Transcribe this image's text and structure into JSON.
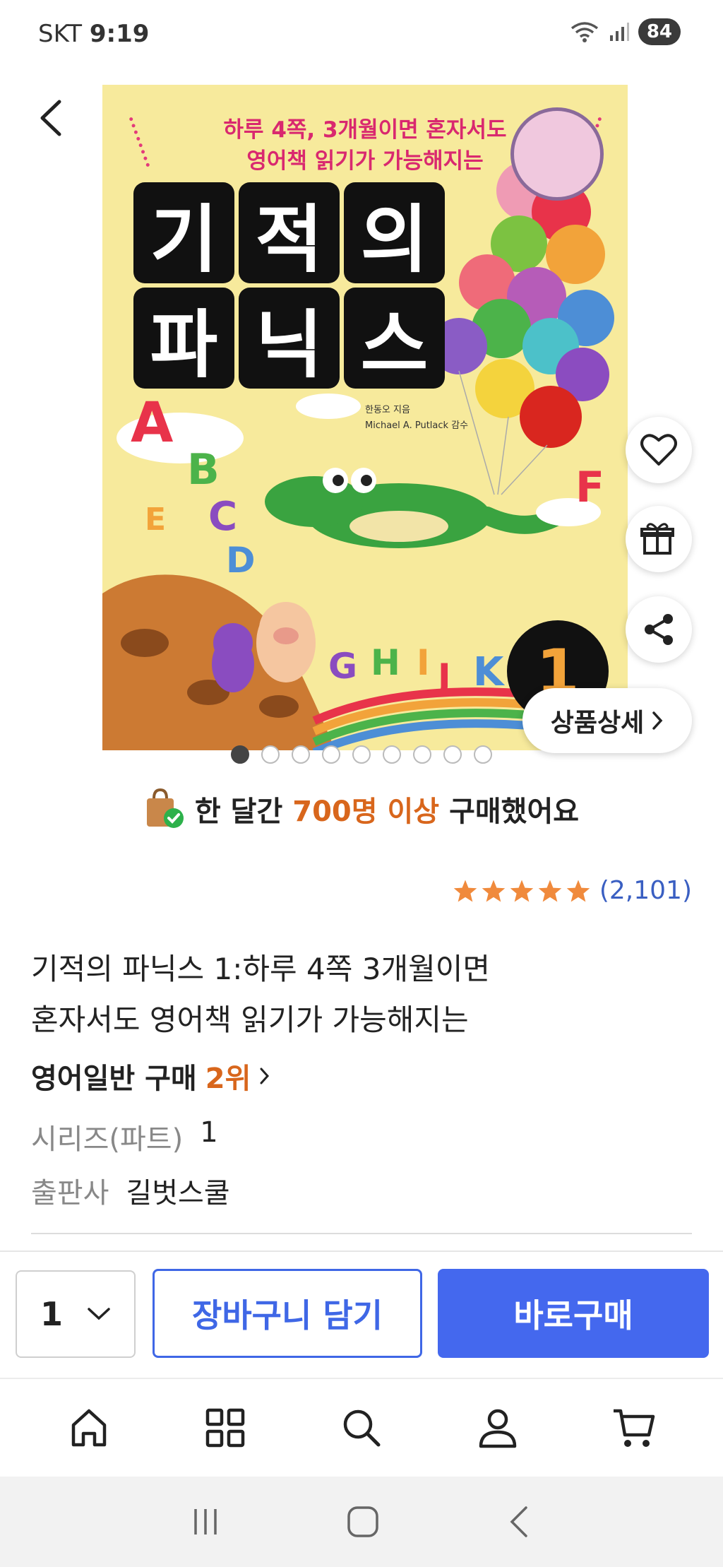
{
  "status_bar": {
    "carrier": "SKT",
    "time": "9:19",
    "battery": "84"
  },
  "cover": {
    "subtitle_line1": "하루 4쪽, 3개월이면 혼자서도",
    "subtitle_line2": "영어책 읽기가 가능해지는",
    "title_tiles": [
      "기",
      "적",
      "의",
      "파",
      "닉",
      "스"
    ],
    "author_line1": "한동오 지음",
    "author_line2": "Michael A. Putlack 감수",
    "volume": "1",
    "letters": [
      "A",
      "B",
      "C",
      "D",
      "E",
      "F",
      "G",
      "H",
      "I",
      "J",
      "K"
    ]
  },
  "side_actions": {
    "detail_label": "상품상세"
  },
  "pagination": {
    "total": 9,
    "active_index": 0
  },
  "purchase_banner": {
    "prefix": "한 달간",
    "highlight": "700명 이상",
    "suffix": "구매했어요"
  },
  "rating": {
    "stars": 5,
    "count": "(2,101)"
  },
  "product": {
    "title_line1": "기적의 파닉스 1:하루 4쪽 3개월이면",
    "title_line2": "혼자서도 영어책 읽기가 가능해지는",
    "rank_category": "영어일반 구매",
    "rank": "2위",
    "series_label": "시리즈(파트)",
    "series_value": "1",
    "publisher_label": "출판사",
    "publisher_value": "길벗스쿨"
  },
  "action_bar": {
    "quantity": "1",
    "cart_label": "장바구니 담기",
    "buy_label": "바로구매"
  },
  "tabbar": {
    "icons": [
      "home-icon",
      "category-grid-icon",
      "search-icon",
      "user-icon",
      "cart-icon"
    ]
  },
  "colors": {
    "accent_blue": "#4468ee",
    "highlight_orange": "#d8661c",
    "star": "#f08a3c"
  }
}
